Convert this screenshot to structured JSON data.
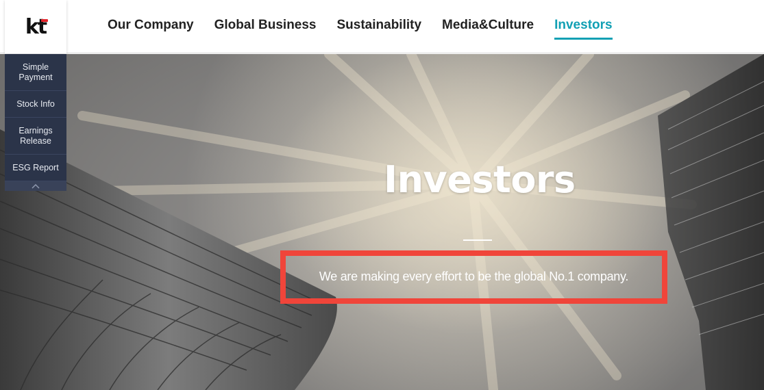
{
  "logo": {
    "text": "kt",
    "accent_color": "#e4232a"
  },
  "nav": {
    "items": [
      {
        "label": "Our Company"
      },
      {
        "label": "Global Business"
      },
      {
        "label": "Sustainability"
      },
      {
        "label": "Media&Culture"
      },
      {
        "label": "Investors",
        "active": true
      }
    ],
    "active_color": "#12a0b4"
  },
  "quick_menu": {
    "items": [
      {
        "label": "Simple Payment"
      },
      {
        "label": "Stock Info"
      },
      {
        "label": "Earnings Release"
      },
      {
        "label": "ESG Report"
      }
    ],
    "up_icon": "chevron-up-icon",
    "background": "#2b3449"
  },
  "hero": {
    "title": "Investors",
    "subtitle": "We are making every effort to be the global No.1 company.",
    "highlight_color": "#f0453a"
  }
}
